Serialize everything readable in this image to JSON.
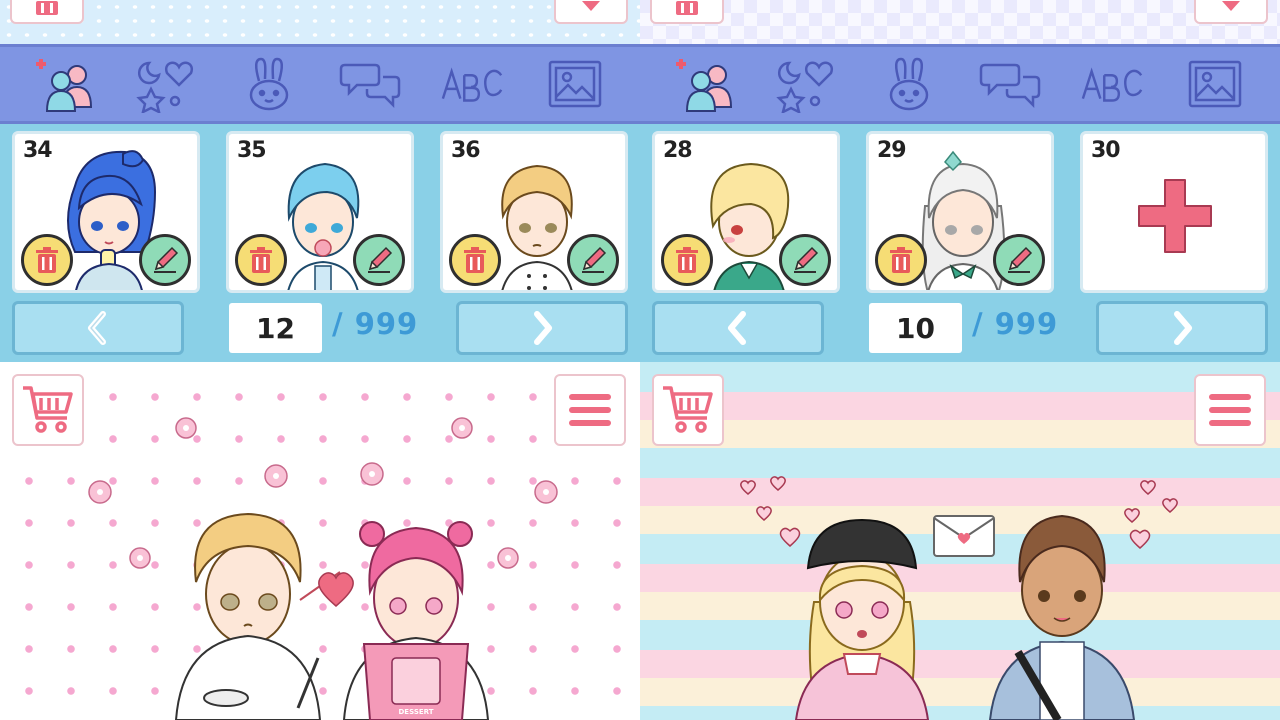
{
  "colors": {
    "category_bar": "#7f95e3",
    "slots_background": "#8ad0e7",
    "page_total_text": "#3d9ad6",
    "accent_pink": "#ee6b82"
  },
  "category_icons": [
    "add-character-icon",
    "stickers-icon",
    "animal-icon",
    "speech-bubble-icon",
    "text-abc-icon",
    "background-image-icon"
  ],
  "left_panel": {
    "slots": [
      {
        "number": "34",
        "character": "blue-haired-girl"
      },
      {
        "number": "35",
        "character": "blue-haired-boy"
      },
      {
        "number": "36",
        "character": "blonde-chef-boy"
      }
    ],
    "pager": {
      "current": "12",
      "total": "/ 999"
    },
    "scene": {
      "apron_text": "DESSERT"
    }
  },
  "right_panel": {
    "slots": [
      {
        "number": "28",
        "character": "blonde-boy-uniform"
      },
      {
        "number": "29",
        "character": "white-haired-girl"
      },
      {
        "number": "30",
        "character": "empty-add-slot"
      }
    ],
    "pager": {
      "current": "10",
      "total": "/ 999"
    }
  }
}
